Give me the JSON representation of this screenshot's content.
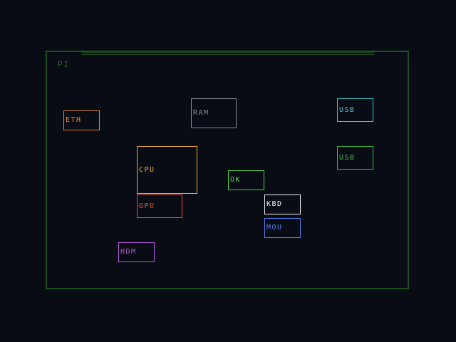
{
  "board": {
    "label": "PI",
    "border_color": "#1e4d1e",
    "label_color": "#2b5a2b"
  },
  "components": [
    {
      "id": "c-eth",
      "name": "eth-port",
      "label": "ETH",
      "color": "#e8873a"
    },
    {
      "id": "c-ram",
      "name": "ram-chip",
      "label": "RAM",
      "color": "#8a8a8a"
    },
    {
      "id": "c-usb1",
      "name": "usb-port-1",
      "label": "USB",
      "color": "#3ec8c8"
    },
    {
      "id": "c-usb2",
      "name": "usb-port-2",
      "label": "USB",
      "color": "#3cb84a"
    },
    {
      "id": "c-cpu",
      "name": "cpu-chip",
      "label": "CPU",
      "color": "#f0b040"
    },
    {
      "id": "c-ok",
      "name": "ok-led",
      "label": "OK",
      "color": "#4ccf4c"
    },
    {
      "id": "c-gpu",
      "name": "gpu-chip",
      "label": "GPU",
      "color": "#e8503a"
    },
    {
      "id": "c-kbd",
      "name": "keyboard-port",
      "label": "KBD",
      "color": "#f2f2f2"
    },
    {
      "id": "c-mou",
      "name": "mouse-port",
      "label": "MOU",
      "color": "#5a7ef0"
    },
    {
      "id": "c-hdm",
      "name": "hdmi-port",
      "label": "HDM",
      "color": "#b05ad8"
    }
  ]
}
